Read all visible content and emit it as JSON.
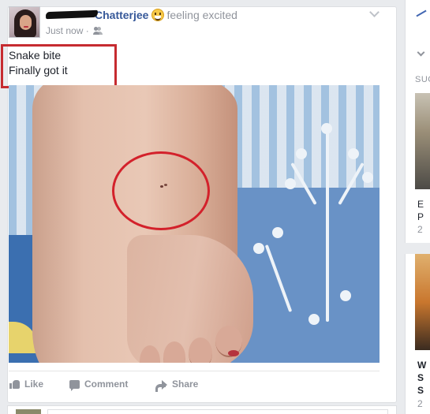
{
  "post": {
    "author_suffix": "Chatterjee",
    "feeling": "feeling excited",
    "timestamp": "Just now",
    "text_line1": "Snake bite",
    "text_line2": "Finally got it",
    "audience_icon": "friends-icon",
    "menu_icon": "chevron-down-icon"
  },
  "actions": {
    "like": "Like",
    "comment": "Comment",
    "share": "Share"
  },
  "sidebar": {
    "label": "SUG",
    "item1_letters": [
      "E",
      "P",
      "2"
    ],
    "item2_letters": [
      "W",
      "S",
      "S",
      "2"
    ]
  },
  "colors": {
    "link": "#365899",
    "meta": "#90949c",
    "annotation_red": "#c62b30",
    "circle_red": "#d3212b"
  }
}
